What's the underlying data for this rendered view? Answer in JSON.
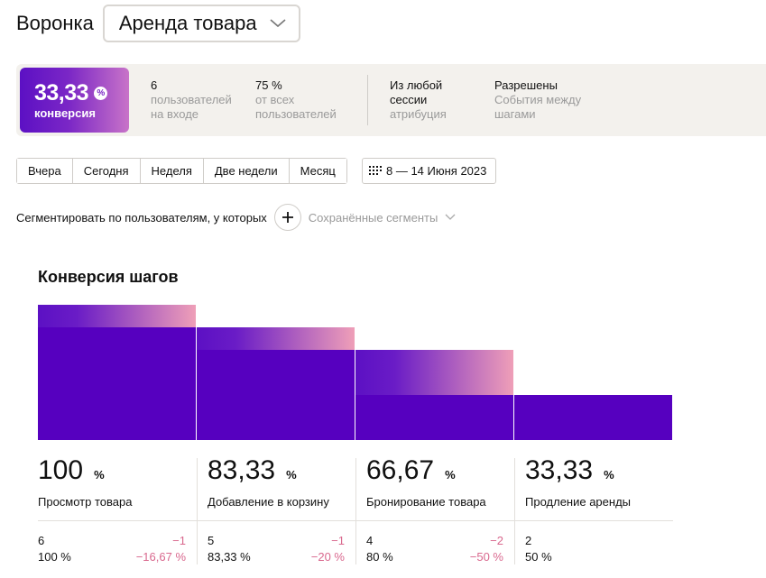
{
  "header": {
    "title": "Воронка",
    "funnel_name": "Аренда товара"
  },
  "summary": {
    "conversion_value": "33,33",
    "conversion_unit": "%",
    "conversion_label": "конверсия",
    "users_value": "6",
    "users_label_1": "пользователей",
    "users_label_2": "на входе",
    "share_value": "75 %",
    "share_label_1": "от всех",
    "share_label_2": "пользователей",
    "attribution_line_1": "Из любой",
    "attribution_line_2": "сессии",
    "attribution_label": "атрибуция",
    "events_value": "Разрешены",
    "events_label_1": "События между",
    "events_label_2": "шагами"
  },
  "periods": [
    "Вчера",
    "Сегодня",
    "Неделя",
    "Две недели",
    "Месяц"
  ],
  "date_range": "8 — 14 Июня 2023",
  "segment": {
    "label": "Сегментировать по пользователям, у которых",
    "saved": "Сохранённые сегменты"
  },
  "section_title": "Конверсия шагов",
  "colors": {
    "bar": "#5600bf",
    "gradient_start": "#5c10c4",
    "gradient_end": "#ef9fb8",
    "negative": "#d9688e"
  },
  "chart_data": {
    "type": "bar",
    "categories": [
      "Просмотр товара",
      "Добавление в корзину",
      "Бронирование товара",
      "Продление аренды"
    ],
    "users": [
      6,
      5,
      4,
      2
    ],
    "values": [
      100,
      83.33,
      66.67,
      33.33
    ],
    "ylim": [
      0,
      6
    ]
  },
  "steps": [
    {
      "pct": "100",
      "unit": "%",
      "name": "Просмотр товара",
      "users": "6",
      "drop": "−1",
      "share": "100 %",
      "drop_pct": "−16,67 %"
    },
    {
      "pct": "83,33",
      "unit": "%",
      "name": "Добавление в корзину",
      "users": "5",
      "drop": "−1",
      "share": "83,33 %",
      "drop_pct": "−20 %"
    },
    {
      "pct": "66,67",
      "unit": "%",
      "name": "Бронирование товара",
      "users": "4",
      "drop": "−2",
      "share": "80 %",
      "drop_pct": "−50 %"
    },
    {
      "pct": "33,33",
      "unit": "%",
      "name": "Продление аренды",
      "users": "2",
      "drop": "",
      "share": "50 %",
      "drop_pct": ""
    }
  ]
}
